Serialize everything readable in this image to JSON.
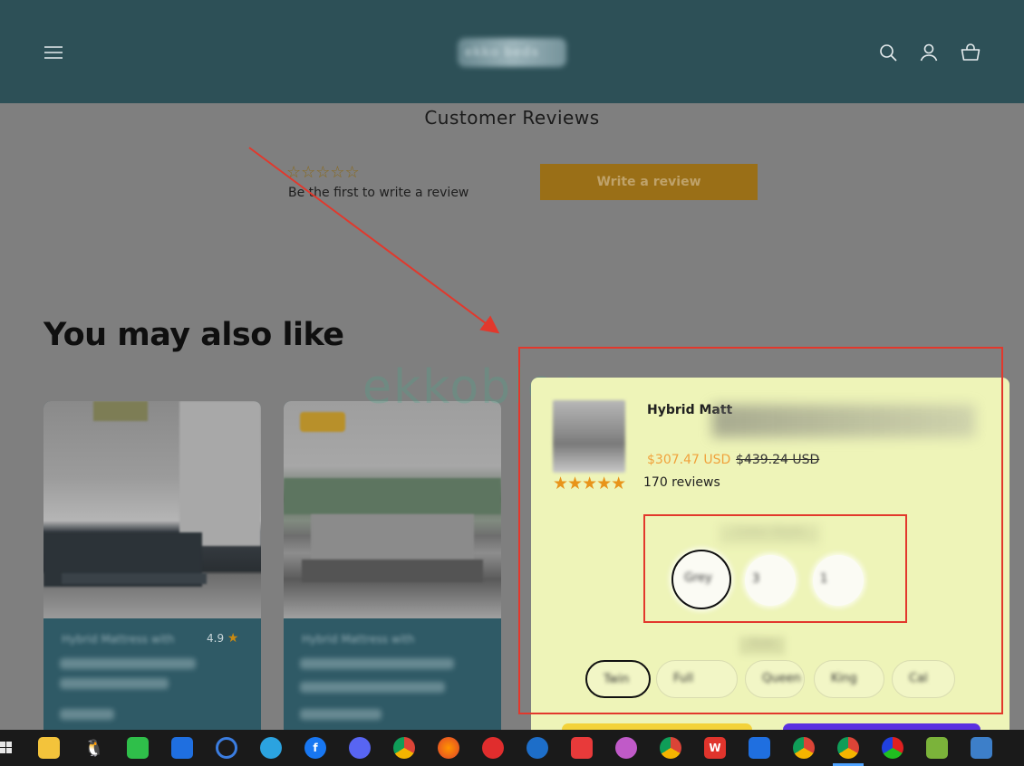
{
  "header": {
    "menu_icon": "hamburger-menu-icon",
    "logo_text": "ekko beds",
    "search_icon": "search-icon",
    "account_icon": "user-icon",
    "cart_icon": "cart-icon",
    "background": "#2d5057"
  },
  "reviews": {
    "title": "Customer Reviews",
    "stars": "☆☆☆☆☆",
    "empty_text": "Be the first to write a review",
    "write_button": "Write a review",
    "button_color": "#9a6f17"
  },
  "also_like": {
    "heading": "You may also like",
    "cards": [
      {
        "title": "Hybrid Mattress with",
        "rating": "4.9",
        "star": "★"
      },
      {
        "title": "Hybrid Mattress with",
        "rating": "",
        "star": ""
      }
    ]
  },
  "popup": {
    "title": "Hybrid Matt",
    "price": "$307.47 USD",
    "compare_price": "$439.24 USD",
    "stars": "★★★★★",
    "reviews": "170 reviews",
    "option_label": "Color Style",
    "swatches": [
      {
        "label": "Grey",
        "selected": true
      },
      {
        "label": "3",
        "selected": false
      },
      {
        "label": "1",
        "selected": false
      }
    ],
    "size_label": "Size",
    "sizes": [
      {
        "label": "Twin",
        "selected": true
      },
      {
        "label": "Full",
        "selected": false
      },
      {
        "label": "Queen",
        "selected": false
      },
      {
        "label": "King",
        "selected": false
      },
      {
        "label": "Cal",
        "selected": false
      }
    ],
    "price_color": "#f0a23c",
    "background": "#eef4b8"
  },
  "watermark": "ekkoblog",
  "taskbar": {
    "icons": [
      "windows-start-icon",
      "file-explorer-icon",
      "qq-icon",
      "wechat-icon",
      "feishu-icon",
      "search-app-icon",
      "telegram-icon",
      "facebook-icon",
      "discord-icon",
      "chrome-icon",
      "firefox-icon",
      "netease-music-icon",
      "edge-icon",
      "netease-cloud-icon",
      "cat-app-icon",
      "chrome-c-icon",
      "wps-icon",
      "lark-icon",
      "chrome-l-icon",
      "chrome-active-icon",
      "color-wheel-icon",
      "notepad-icon",
      "remote-desktop-icon"
    ]
  }
}
